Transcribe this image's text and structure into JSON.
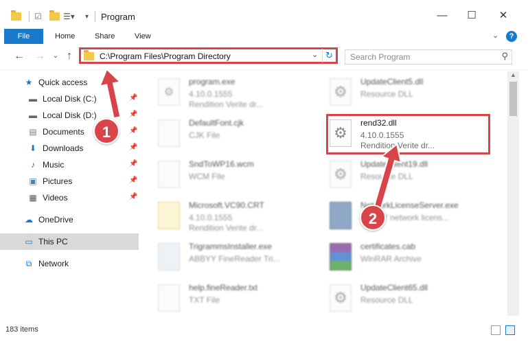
{
  "window": {
    "title": "Program",
    "controls": {
      "minimize": "—",
      "maximize": "☐",
      "close": "✕"
    }
  },
  "ribbon": {
    "tabs": [
      "File",
      "Home",
      "Share",
      "View"
    ],
    "help": "?"
  },
  "navigation": {
    "back": "←",
    "forward": "→",
    "up": "↑",
    "address": "C:\\Program Files\\Program Directory",
    "search_placeholder": "Search Program"
  },
  "sidebar": {
    "quick_access": "Quick access",
    "items": [
      {
        "label": "Local Disk (C:)",
        "icon": "drive-icon",
        "pinned": true
      },
      {
        "label": "Local Disk (D:)",
        "icon": "drive-icon",
        "pinned": true
      },
      {
        "label": "Documents",
        "icon": "documents-icon",
        "pinned": true
      },
      {
        "label": "Downloads",
        "icon": "downloads-icon",
        "pinned": true
      },
      {
        "label": "Music",
        "icon": "music-icon",
        "pinned": true
      },
      {
        "label": "Pictures",
        "icon": "pictures-icon",
        "pinned": true
      },
      {
        "label": "Videos",
        "icon": "videos-icon",
        "pinned": true
      }
    ],
    "onedrive": "OneDrive",
    "this_pc": "This PC",
    "network": "Network"
  },
  "files": [
    {
      "name": "program.exe",
      "version": "4.10.0.1555",
      "desc": "Rendition Verite dr...",
      "icon": "exe-icon"
    },
    {
      "name": "UpdateClient5.dll",
      "version": "Resource DLL",
      "desc": "",
      "icon": "dll-gear-icon"
    },
    {
      "name": "DefaultFont.cjk",
      "version": "CJK File",
      "desc": "",
      "icon": "blank-doc-icon"
    },
    {
      "name": "rend32.dll",
      "version": "4.10.0.1555",
      "desc": "Rendition Verite dr...",
      "icon": "dll-gear-icon"
    },
    {
      "name": "SndToWP16.wcm",
      "version": "WCM File",
      "desc": "",
      "icon": "blank-doc-icon"
    },
    {
      "name": "UpdateClient19.dll",
      "version": "Resource DLL",
      "desc": "",
      "icon": "dll-gear-icon"
    },
    {
      "name": "Microsoft.VC90.CRT",
      "version": "4.10.0.1555",
      "desc": "Rendition Verite dr...",
      "icon": "folder-doc-icon"
    },
    {
      "name": "NetworkLicenseServer.exe",
      "version": "ABBYY network licens...",
      "desc": "",
      "icon": "app-icon"
    },
    {
      "name": "TrigrammsInstaller.exe",
      "version": "ABBYY FineReader Tri...",
      "desc": "",
      "icon": "exe-icon"
    },
    {
      "name": "certificates.cab",
      "version": "WinRAR Archive",
      "desc": "",
      "icon": "winrar-icon"
    },
    {
      "name": "help.fineReader.txt",
      "version": "TXT File",
      "desc": "",
      "icon": "blank-doc-icon"
    },
    {
      "name": "UpdateClient65.dll",
      "version": "Resource DLL",
      "desc": "",
      "icon": "dll-gear-icon"
    }
  ],
  "markers": {
    "step1": "1",
    "step2": "2"
  },
  "status": {
    "items": "183 items"
  },
  "colors": {
    "accent": "#1979ca",
    "highlight": "#d9434a",
    "selected": "#d9d9d9"
  }
}
